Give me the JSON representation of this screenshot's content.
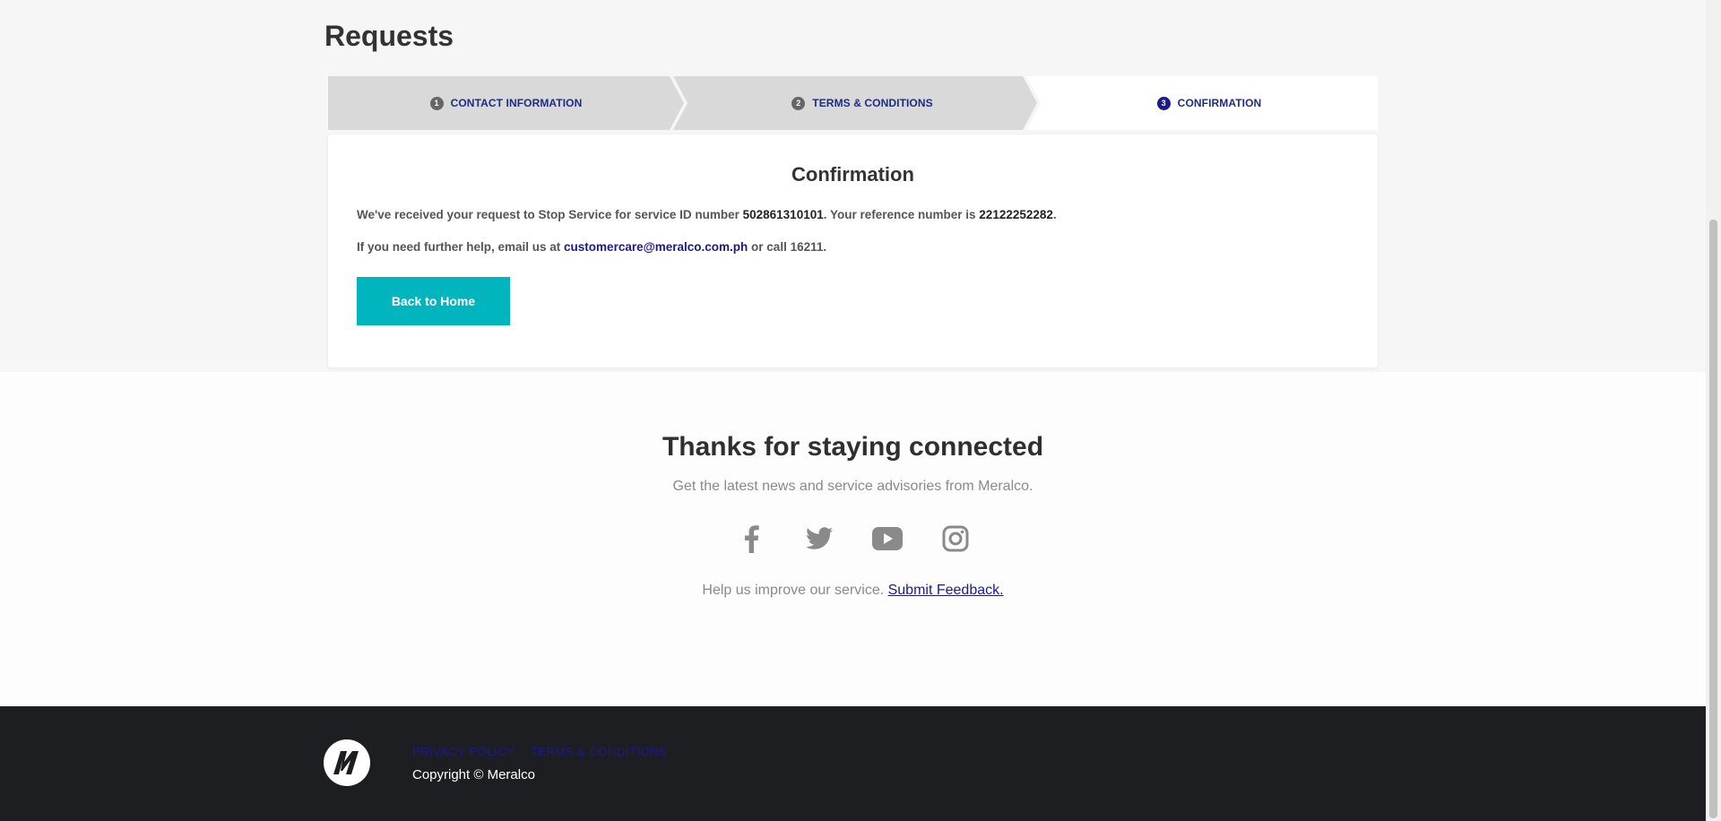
{
  "page": {
    "title": "Requests"
  },
  "stepper": {
    "steps": [
      {
        "number": "1",
        "label": "CONTACT INFORMATION"
      },
      {
        "number": "2",
        "label": "TERMS & CONDITIONS"
      },
      {
        "number": "3",
        "label": "CONFIRMATION"
      }
    ],
    "active_step": 3
  },
  "confirmation": {
    "title": "Confirmation",
    "line1_prefix": "We've received your request to Stop Service for service ID number ",
    "service_id": "502861310101",
    "line1_middle": ". Your reference number is ",
    "reference_number": "22122252282",
    "line1_suffix": ".",
    "line2_prefix": "If you need further help, email us at ",
    "email": "customercare@meralco.com.ph",
    "line2_suffix": " or call 16211.",
    "back_button": "Back to Home"
  },
  "connected": {
    "title": "Thanks for staying connected",
    "subtitle": "Get the latest news and service advisories from Meralco.",
    "socials": [
      "facebook-icon",
      "twitter-icon",
      "youtube-icon",
      "instagram-icon"
    ],
    "feedback_prefix": "Help us improve our service. ",
    "feedback_link": "Submit Feedback."
  },
  "footer": {
    "links": [
      "PRIVACY POLICY",
      "TERMS & CONDITIONS"
    ],
    "copyright": "Copyright © Meralco"
  },
  "colors": {
    "accent": "#00b5bd",
    "link": "#1c1a8a",
    "footer_bg": "#1c1e21",
    "band_bg": "#f6f6f6"
  }
}
